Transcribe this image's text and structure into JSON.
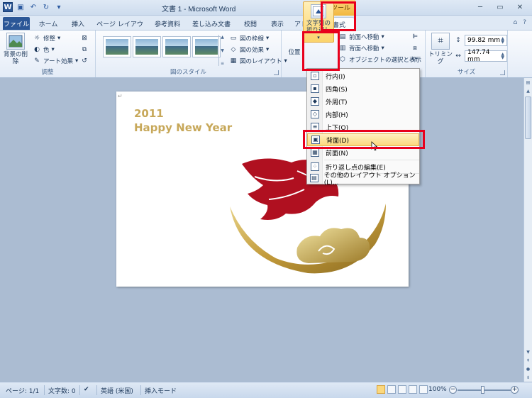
{
  "titlebar": {
    "title": "文書 1 - Microsoft Word",
    "context_header": "図ツール",
    "quick_access": {
      "logo": "W",
      "save_icon": "save-icon",
      "undo_icon": "undo-icon",
      "redo_icon": "redo-icon"
    },
    "controls": {
      "minimize": "─",
      "restore": "▭",
      "close": "✕"
    }
  },
  "tabs": [
    {
      "label": "ファイル",
      "kind": "file"
    },
    {
      "label": "ホーム"
    },
    {
      "label": "挿入"
    },
    {
      "label": "ページ レイアウト"
    },
    {
      "label": "参考資料"
    },
    {
      "label": "差し込み文書"
    },
    {
      "label": "校閲"
    },
    {
      "label": "表示"
    },
    {
      "label": "アドイン"
    },
    {
      "label": "書式",
      "active": true
    }
  ],
  "tabs_right": {
    "collapse": "⌂",
    "help": "?"
  },
  "ribbon": {
    "adjust": {
      "label": "調整",
      "remove_bg": "背景の削除",
      "corrections": "修整",
      "color": "色",
      "art_effects": "アート効果"
    },
    "styles": {
      "label": "図のスタイル",
      "border": "図の枠線",
      "effects": "図の効果",
      "layout": "図のレイアウト"
    },
    "arrange": {
      "position": "位置",
      "wrap_text": "文字列の折り返し",
      "bring_forward": "前面へ移動",
      "send_backward": "背面へ移動",
      "selection_pane": "オブジェクトの選択と表示"
    },
    "size": {
      "label": "サイズ",
      "crop": "トリミング",
      "height": "99.82 mm",
      "width": "147.74 mm"
    }
  },
  "document": {
    "year": "2011",
    "greeting": "Happy New Year"
  },
  "wrap_menu": {
    "items": [
      {
        "label": "行内(I)",
        "hover": false
      },
      {
        "label": "四角(S)",
        "hover": false
      },
      {
        "label": "外周(T)",
        "hover": false
      },
      {
        "label": "内部(H)",
        "hover": false
      },
      {
        "label": "上下(O)",
        "hover": false
      },
      {
        "label": "背面(D)",
        "hover": true
      },
      {
        "label": "前面(N)",
        "hover": false
      },
      {
        "label": "折り返し点の編集(E)",
        "hover": false
      },
      {
        "label": "その他のレイアウト オプション(L)...",
        "hover": false
      }
    ]
  },
  "statusbar": {
    "page": "ページ: 1/1",
    "words": "文字数: 0",
    "language": "英語 (米国)",
    "mode": "挿入モード",
    "zoom": "100%"
  },
  "colors": {
    "accent_red": "#e8001c",
    "gold": "#c7a85a",
    "crimson": "#b01020",
    "file_tab": "#2b5797",
    "highlight": "#fbd87d"
  }
}
